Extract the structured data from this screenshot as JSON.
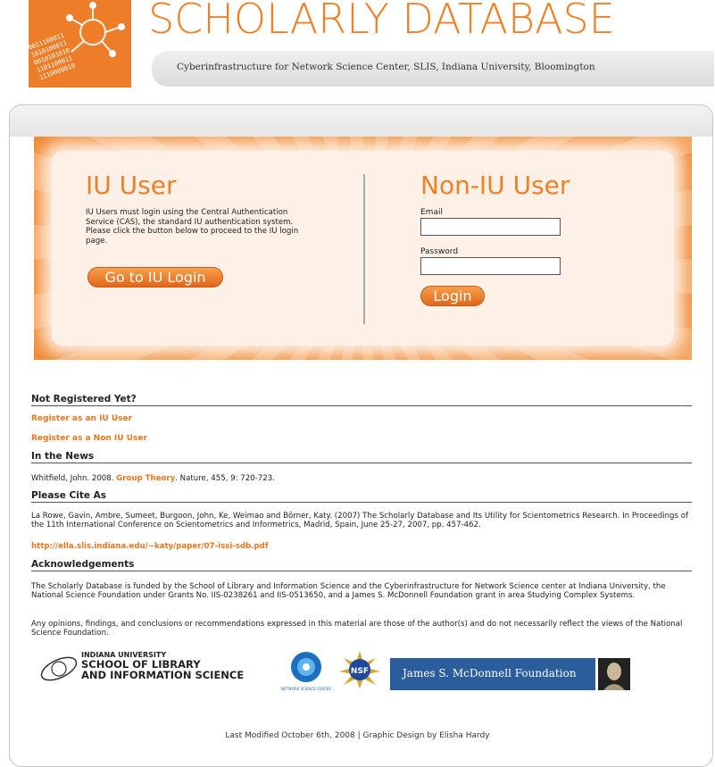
{
  "header": {
    "title": "SCHOLARLY DATABASE",
    "subtitle": "Cyberinfrastructure for Network Science Center, SLIS, Indiana University, Bloomington",
    "logo_digits": [
      "0011100011",
      "1010100011",
      "0010101010",
      "1101100011",
      "1110000010"
    ]
  },
  "iu_user": {
    "title": "IU User",
    "description": "IU Users must login using the Central Authentication Service (CAS), the standard IU authentication system. Please click the button below to proceed to the IU login page.",
    "button": "Go to IU Login"
  },
  "non_iu_user": {
    "title": "Non-IU User",
    "email_label": "Email",
    "email_value": "",
    "password_label": "Password",
    "password_value": "",
    "button": "Login"
  },
  "not_registered": {
    "heading": "Not Registered Yet?",
    "link_iu": "Register as an IU User",
    "link_non_iu": "Register as a Non IU User"
  },
  "news": {
    "heading": "In the News",
    "prefix": "Whitfield, John. 2008.",
    "link": "Group Theory",
    "suffix": ". Nature, 455, 9: 720-723."
  },
  "cite": {
    "heading": "Please Cite As",
    "text": "La Rowe, Gavin, Ambre, Sumeet, Burgoon, John, Ke, Weimao and Börner, Katy. (2007) The Scholarly Database and Its Utility for Scientometrics Research. In Proceedings of the 11th International Conference on Scientometrics and Informetrics, Madrid, Spain, June 25-27, 2007, pp. 457-462.",
    "link": "http://ella.slis.indiana.edu/~katy/paper/07-issi-sdb.pdf"
  },
  "ack": {
    "heading": "Acknowledgements",
    "p1": "The Scholarly Database is funded by the School of Library and Information Science and the Cyberinfrastructure for Network Science center at Indiana University, the National Science Foundation under Grants No. IIS-0238261 and IIS-0513650, and a James S. McDonnell Foundation grant in area Studying Complex Systems.",
    "p2": "Any opinions, findings, and conclusions or recommendations expressed in this material are those of the author(s) and do not necessarily reflect the views of the National Science Foundation."
  },
  "logos": {
    "iu_small": "INDIANA UNIVERSITY",
    "iu_line1": "SCHOOL OF LIBRARY",
    "iu_line2": "AND INFORMATION SCIENCE",
    "cns_caption": "NETWORK SCIENCE CENTER",
    "nsf": "NSF",
    "jsmf": "James S. McDonnell Foundation"
  },
  "footer": "Last Modified October 6th, 2008 | Graphic Design by Elisha Hardy",
  "colors": {
    "accent": "#f08025",
    "accent_dark": "#e0661a",
    "cream": "#fdf0e6",
    "jsmf_blue": "#2b5d9c"
  }
}
